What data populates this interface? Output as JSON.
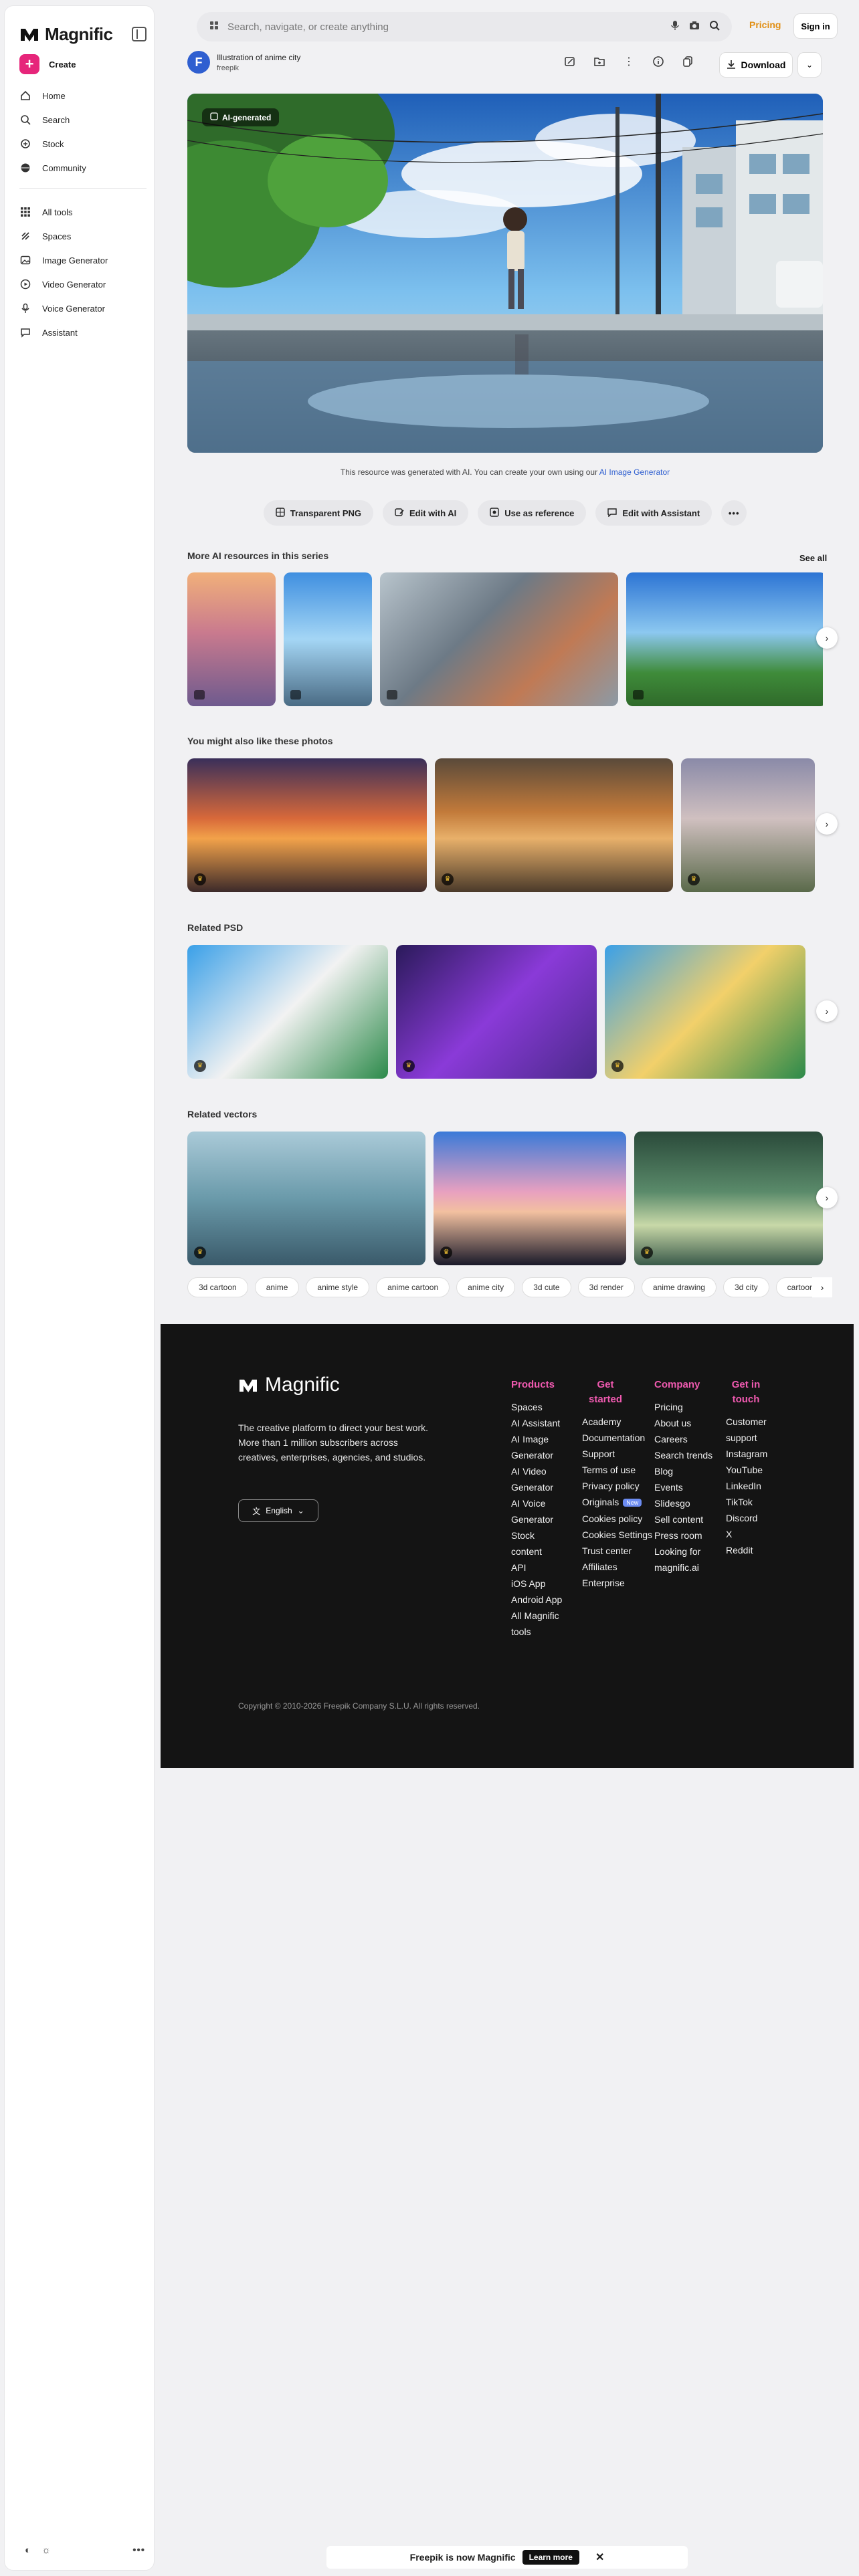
{
  "app": {
    "brand": "Magnific"
  },
  "sidebar": {
    "create_label": "Create",
    "nav": [
      {
        "label": "Home",
        "icon": "home-icon"
      },
      {
        "label": "Search",
        "icon": "search-icon"
      },
      {
        "label": "Stock",
        "icon": "stock-icon"
      },
      {
        "label": "Community",
        "icon": "globe-icon"
      }
    ],
    "tools": [
      {
        "label": "All tools",
        "icon": "grid-icon"
      },
      {
        "label": "Spaces",
        "icon": "spaces-icon"
      },
      {
        "label": "Image Generator",
        "icon": "image-icon"
      },
      {
        "label": "Video Generator",
        "icon": "video-icon"
      },
      {
        "label": "Voice Generator",
        "icon": "mic-icon"
      },
      {
        "label": "Assistant",
        "icon": "chat-icon"
      }
    ],
    "more": "•••"
  },
  "topbar": {
    "search_placeholder": "Search, navigate, or create anything",
    "pricing": "Pricing",
    "signin": "Sign in"
  },
  "resource": {
    "title": "Illustration of anime city",
    "author": "freepik",
    "author_initial": "F",
    "download": "Download",
    "badge": "AI-generated",
    "note_prefix": "This resource was generated with  AI. You can create your own using our ",
    "note_link": "AI Image Generator"
  },
  "pills": [
    {
      "label": "Transparent PNG"
    },
    {
      "label": "Edit with AI"
    },
    {
      "label": "Use as reference"
    },
    {
      "label": "Edit with Assistant"
    }
  ],
  "sections": {
    "series": {
      "title": "More AI resources in this series",
      "see_all": "See all"
    },
    "photos": {
      "title": "You might also like these photos"
    },
    "psd": {
      "title": "Related PSD"
    },
    "vectors": {
      "title": "Related vectors"
    }
  },
  "tags": [
    "3d cartoon",
    "anime",
    "anime style",
    "anime cartoon",
    "anime city",
    "3d cute",
    "3d render",
    "anime drawing",
    "3d city",
    "cartoon"
  ],
  "footer": {
    "brand": "Magnific",
    "description": "The creative platform to direct your best work. More than 1 million subscribers across creatives, enterprises, agencies, and studios.",
    "language": "English",
    "new_badge": "New",
    "columns": [
      {
        "title": "Products",
        "items": [
          "Spaces",
          "AI Assistant",
          "AI Image Generator",
          "AI Video Generator",
          "AI Voice Generator",
          "Stock content",
          "API",
          "iOS App",
          "Android App",
          "All Magnific tools"
        ]
      },
      {
        "title": "Get started",
        "items": [
          "Academy",
          "Documentation",
          "Support",
          "Terms of use",
          "Privacy policy",
          "Originals",
          "Cookies policy",
          "Cookies Settings",
          "Trust center",
          "Affiliates",
          "Enterprise"
        ]
      },
      {
        "title": "Company",
        "items": [
          "Pricing",
          "About us",
          "Careers",
          "Search trends",
          "Blog",
          "Events",
          "Slidesgo",
          "Sell content",
          "Press room",
          "Looking for magnific.ai"
        ]
      },
      {
        "title": "Get in touch",
        "items": [
          "Customer support",
          "Instagram",
          "YouTube",
          "LinkedIn",
          "TikTok",
          "Discord",
          "X",
          "Reddit"
        ]
      }
    ],
    "copyright": "Copyright © 2010-2026 Freepik Company S.L.U. All rights reserved."
  },
  "banner": {
    "text": "Freepik is now Magnific",
    "button": "Learn more",
    "close": "✕"
  }
}
